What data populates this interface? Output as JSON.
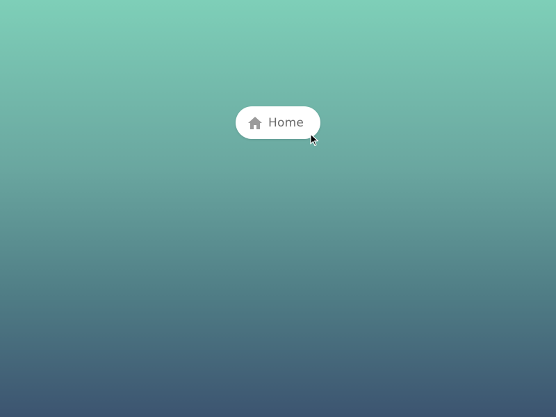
{
  "background": {
    "gradient_top": "#7ecfb8",
    "gradient_bottom": "#3c5470"
  },
  "home_button": {
    "label": "Home",
    "icon": "home-icon",
    "background_color": "#ffffff",
    "text_color": "#6b6b6b",
    "icon_color": "#9a9a9a"
  },
  "cursor": {
    "icon": "mouse-pointer-icon"
  }
}
